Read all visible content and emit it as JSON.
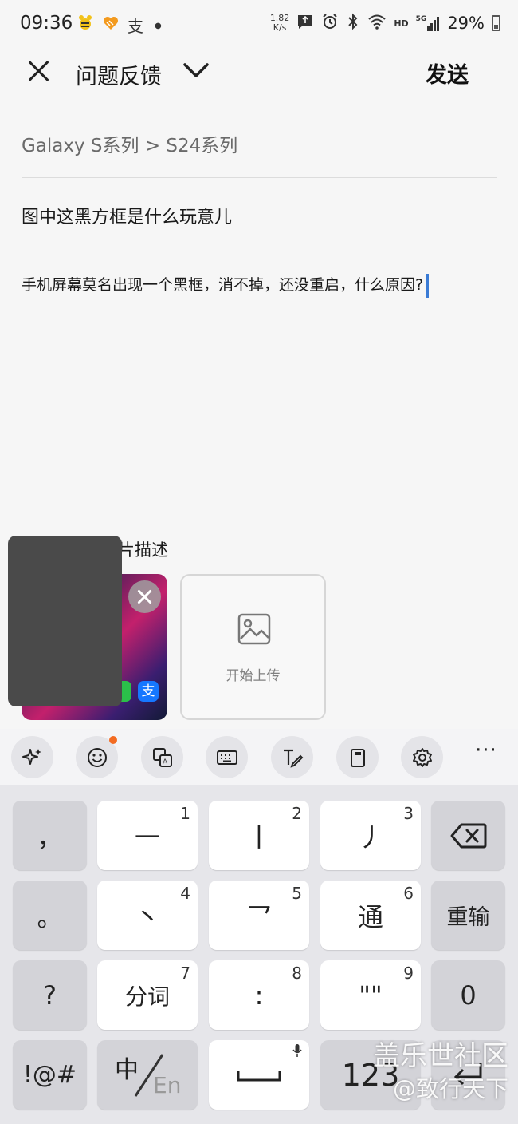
{
  "status_bar": {
    "time": "09:36",
    "app_icons": [
      "bee-icon",
      "heart-app-icon",
      "alipay-icon"
    ],
    "net_speed_value": "1.82",
    "net_speed_unit": "K/s",
    "network": "5G",
    "hd": "HD",
    "battery": "29%"
  },
  "header": {
    "title": "问题反馈",
    "send_label": "发送"
  },
  "form": {
    "category": "Galaxy S系列 > S24系列",
    "subject": "图中这黑方框是什么玩意儿",
    "body": "手机屏幕莫名出现一个黑框，消不掉，还没重启，什么原因?",
    "image_desc_label": "片描述",
    "upload_label": "开始上传"
  },
  "toolbar": {
    "items": [
      "ai-sparkle-icon",
      "emoji-icon",
      "translate-icon",
      "keyboard-icon",
      "handwriting-icon",
      "clipboard-icon",
      "settings-icon",
      "more-icon"
    ],
    "more_label": "···"
  },
  "keyboard": {
    "rows": [
      {
        "left": "，",
        "keys": [
          {
            "main": "一",
            "num": "1"
          },
          {
            "main": "丨",
            "num": "2"
          },
          {
            "main": "丿",
            "num": "3"
          }
        ],
        "right": "delete"
      },
      {
        "left": "。",
        "keys": [
          {
            "main": "丶",
            "num": "4"
          },
          {
            "main": "乛",
            "num": "5"
          },
          {
            "main": "通",
            "num": "6"
          }
        ],
        "right": "重输"
      },
      {
        "left": "?",
        "keys": [
          {
            "main": "分词",
            "num": "7"
          },
          {
            "main": ":",
            "num": "8"
          },
          {
            "main": "\"\"",
            "num": "9"
          }
        ],
        "right": "0"
      }
    ],
    "bottom": {
      "symbols": "!@#",
      "lang_cn": "中",
      "lang_en": "En",
      "numbers": "123"
    }
  },
  "watermark": {
    "line1": "盖乐世社区",
    "line2": "@致行天下"
  }
}
